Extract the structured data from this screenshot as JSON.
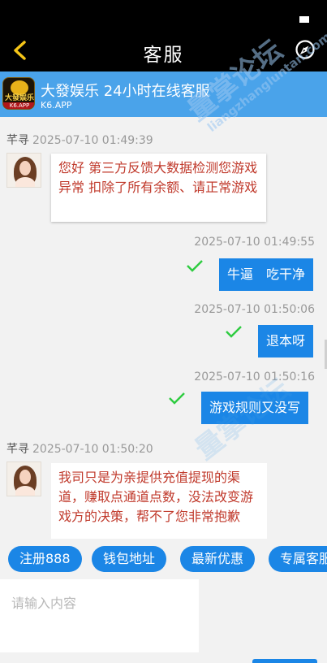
{
  "nav": {
    "title": "客服"
  },
  "banner": {
    "title": "大發娱乐 24小时在线客服",
    "subtitle": "K6.APP",
    "logo_text": "大發娱乐",
    "logo_sub": "K6.APP"
  },
  "messages": [
    {
      "direction": "in",
      "sender": "芊寻",
      "time": "2025-07-10 01:49:39",
      "text": "您好 第三方反馈大数据检测您游戏异常 扣除了所有余额、请正常游戏"
    },
    {
      "direction": "out",
      "time": "2025-07-10 01:49:55",
      "text": "牛逼　吃干净"
    },
    {
      "direction": "out",
      "time": "2025-07-10 01:50:06",
      "text": "退本呀"
    },
    {
      "direction": "out",
      "time": "2025-07-10 01:50:16",
      "text": "游戏规则又没写"
    },
    {
      "direction": "in",
      "sender": "芊寻",
      "time": "2025-07-10 01:50:20",
      "text": "我司只是为亲提供充值提现的渠道，赚取点通道点数，没法改变游戏方的决策，帮不了您非常抱歉"
    }
  ],
  "quick_replies": [
    "注册888",
    "钱包地址",
    "最新优惠",
    "专属客服"
  ],
  "input": {
    "placeholder": "请输入内容"
  },
  "watermark": {
    "text": "量掌论坛",
    "sub": "liangzhangluntan.com"
  },
  "colors": {
    "accent": "#1b86e6",
    "banner": "#4aa3ea",
    "incoming_text": "#c0392b",
    "check": "#2ecc40"
  },
  "icons": {
    "back": "chevron-left-icon",
    "compass": "compass-icon",
    "check": "check-icon"
  }
}
